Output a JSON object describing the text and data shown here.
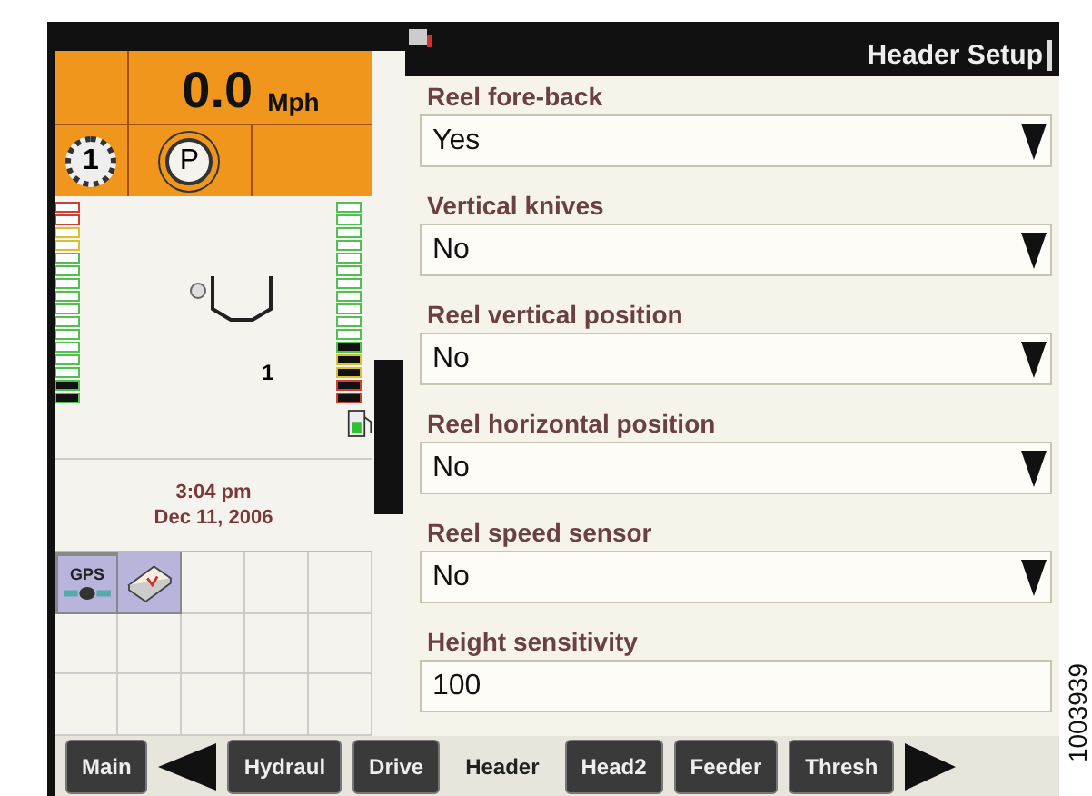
{
  "speed": {
    "value": "0.0",
    "unit": "Mph"
  },
  "gear": "1",
  "park": "P",
  "gauge_count": "1",
  "left_gauge": {
    "level": 0.12
  },
  "right_gauge": {
    "level": 0.3
  },
  "time": "3:04 pm",
  "date": "Dec 11, 2006",
  "gps_label": "GPS",
  "panel_title": "Header Setup",
  "settings": [
    {
      "label": "Reel fore-back",
      "value": "Yes",
      "kind": "dropdown"
    },
    {
      "label": "Vertical knives",
      "value": "No",
      "kind": "dropdown"
    },
    {
      "label": "Reel vertical position",
      "value": "No",
      "kind": "dropdown"
    },
    {
      "label": "Reel horizontal position",
      "value": "No",
      "kind": "dropdown"
    },
    {
      "label": "Reel speed sensor",
      "value": "No",
      "kind": "dropdown"
    },
    {
      "label": "Height sensitivity",
      "value": "100",
      "kind": "number"
    }
  ],
  "nav_tabs": [
    {
      "kind": "tab",
      "label": "Main",
      "selected": false
    },
    {
      "kind": "prev"
    },
    {
      "kind": "tab",
      "label": "Hydraul",
      "selected": false
    },
    {
      "kind": "tab",
      "label": "Drive",
      "selected": false
    },
    {
      "kind": "tab",
      "label": "Header",
      "selected": true
    },
    {
      "kind": "tab",
      "label": "Head2",
      "selected": false
    },
    {
      "kind": "tab",
      "label": "Feeder",
      "selected": false
    },
    {
      "kind": "tab",
      "label": "Thresh",
      "selected": false
    },
    {
      "kind": "next"
    }
  ],
  "figure_number": "1003939"
}
